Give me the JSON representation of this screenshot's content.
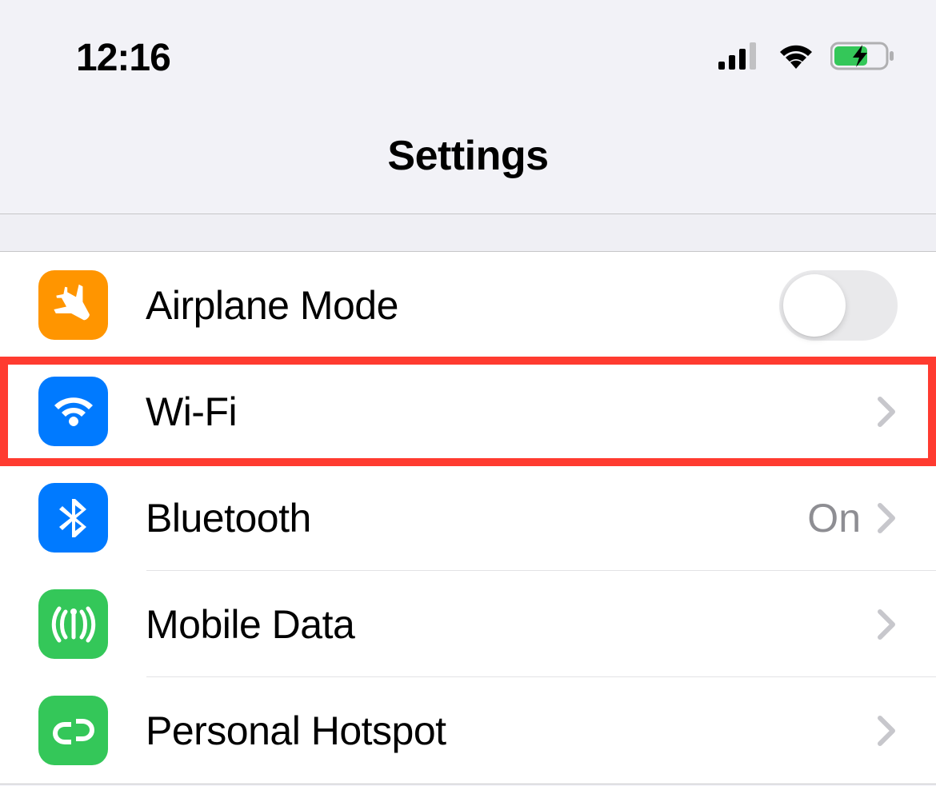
{
  "status": {
    "time": "12:16"
  },
  "header": {
    "title": "Settings"
  },
  "rows": {
    "airplane": {
      "label": "Airplane Mode"
    },
    "wifi": {
      "label": "Wi-Fi"
    },
    "bluetooth": {
      "label": "Bluetooth",
      "value": "On"
    },
    "mobile": {
      "label": "Mobile Data"
    },
    "hotspot": {
      "label": "Personal Hotspot"
    }
  },
  "colors": {
    "orange": "#ff9500",
    "blue": "#007aff",
    "green": "#34c759",
    "highlight": "#ff3b30"
  }
}
